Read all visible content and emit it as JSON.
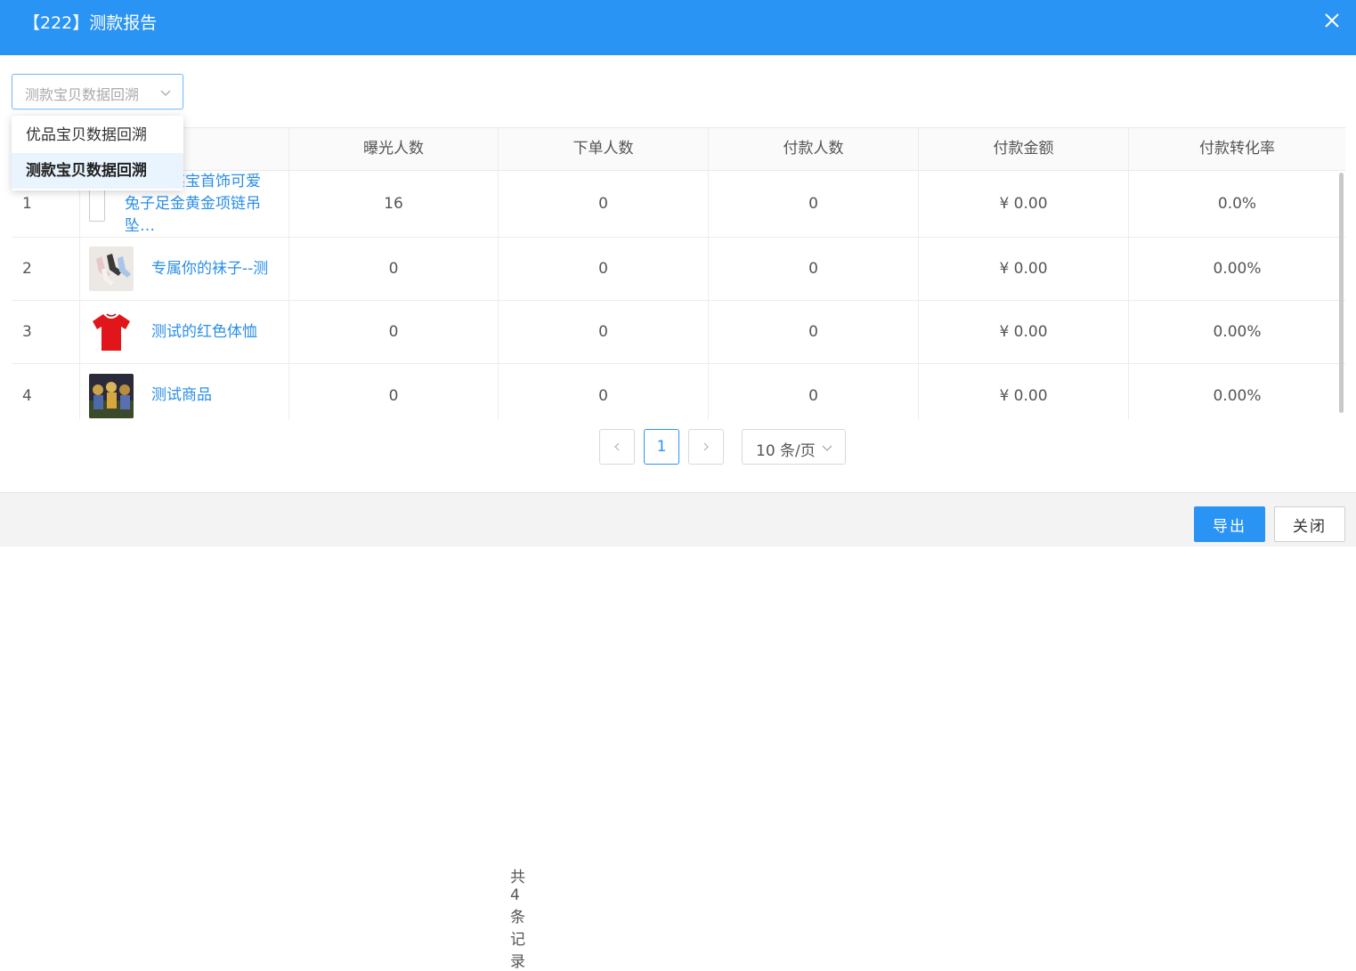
{
  "dialog": {
    "title": "【222】测款报告",
    "close_icon": "close-icon"
  },
  "filter": {
    "placeholder": "测款宝贝数据回溯",
    "options": [
      {
        "label": "优品宝贝数据回溯",
        "selected": false
      },
      {
        "label": "测款宝贝数据回溯",
        "selected": true
      }
    ]
  },
  "table": {
    "columns": [
      "",
      "",
      "曝光人数",
      "下单人数",
      "付款人数",
      "付款金额",
      "付款转化率"
    ],
    "rows": [
      {
        "index": "1",
        "product": "周大福某宝首饰可爱兔子足金黄金项链吊坠…",
        "thumb": "empty-image",
        "exposure": "16",
        "orders": "0",
        "payers": "0",
        "amount": "¥ 0.00",
        "rate": "0.0%"
      },
      {
        "index": "2",
        "product": "专属你的袜子--测",
        "thumb": "socks-image",
        "exposure": "0",
        "orders": "0",
        "payers": "0",
        "amount": "¥ 0.00",
        "rate": "0.00%"
      },
      {
        "index": "3",
        "product": "测试的红色体恤",
        "thumb": "red-tshirt-image",
        "exposure": "0",
        "orders": "0",
        "payers": "0",
        "amount": "¥ 0.00",
        "rate": "0.00%"
      },
      {
        "index": "4",
        "product": "测试商品",
        "thumb": "team-photo-image",
        "exposure": "0",
        "orders": "0",
        "payers": "0",
        "amount": "¥ 0.00",
        "rate": "0.00%"
      }
    ]
  },
  "pagination": {
    "total_label": "共 4 条记录",
    "current_page": "1",
    "page_size_label": "10 条/页"
  },
  "footer": {
    "export_label": "导出",
    "close_label": "关闭"
  },
  "colors": {
    "primary": "#2a94f5",
    "link": "#2a8fe8"
  }
}
